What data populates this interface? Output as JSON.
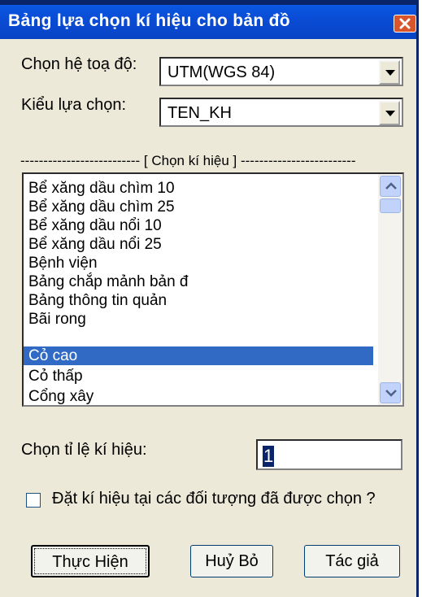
{
  "window": {
    "title": "Bảng lựa chọn kí hiệu cho bản đồ"
  },
  "coord": {
    "label": "Chọn hệ toạ độ:",
    "value": "UTM(WGS 84)"
  },
  "select_type": {
    "label": "Kiểu lựa chọn:",
    "value": "TEN_KH"
  },
  "section": {
    "label": "-------------------------- [ Chọn kí hiệu ] -------------------------"
  },
  "symbol_list": {
    "items": [
      "Bể xăng dầu chìm 10",
      "Bể xăng dầu chìm 25",
      "Bể xăng dầu nổi 10",
      "Bể xăng dầu nổi 25",
      "Bệnh viện",
      "Bảng chắp mảnh bản đ",
      "Bảng thông tin quản",
      "Bãi rong",
      "Cỏ cao",
      "Cỏ thấp",
      "Cổng xây"
    ],
    "selected_index": 8
  },
  "scale": {
    "label": "Chọn tỉ lệ kí hiệu:",
    "value": "1"
  },
  "apply_selected": {
    "label": "Đặt kí hiệu tại các đối tượng đã được chọn ?",
    "checked": false
  },
  "buttons": {
    "execute": "Thực Hiện",
    "cancel": "Huỷ Bỏ",
    "author": "Tác giả"
  },
  "icons": {
    "close": "close-icon",
    "dropdown": "chevron-down-icon",
    "scroll_up": "arrow-up-icon",
    "scroll_down": "arrow-down-icon"
  },
  "colors": {
    "title_bar": "#0a4dd6",
    "selection": "#316ac5",
    "face": "#ece9d8"
  }
}
